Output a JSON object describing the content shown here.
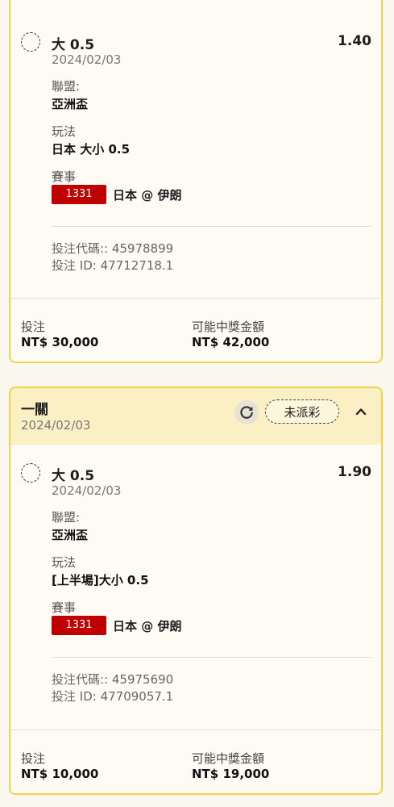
{
  "bets": [
    {
      "leg": {
        "selection": "大 0.5",
        "odds": "1.40",
        "date": "2024/02/03",
        "league_label": "聯盟:",
        "league": "亞洲盃",
        "market_label": "玩法",
        "market": "日本 大小 0.5",
        "match_label": "賽事",
        "match_id": "1331",
        "match_name": "日本 @ 伊朗",
        "bet_code": "投注代碼:: 45978899",
        "bet_id": "投注 ID: 47712718.1"
      },
      "stake_label": "投注",
      "stake": "NT$ 30,000",
      "win_label": "可能中獎金額",
      "win": "NT$ 42,000"
    },
    {
      "header": {
        "title": "一關",
        "date": "2024/02/03",
        "status": "未派彩"
      },
      "leg": {
        "selection": "大 0.5",
        "odds": "1.90",
        "date": "2024/02/03",
        "league_label": "聯盟:",
        "league": "亞洲盃",
        "market_label": "玩法",
        "market": "[上半場]大小 0.5",
        "match_label": "賽事",
        "match_id": "1331",
        "match_name": "日本 @ 伊朗",
        "bet_code": "投注代碼:: 45975690",
        "bet_id": "投注 ID: 47709057.1"
      },
      "stake_label": "投注",
      "stake": "NT$ 10,000",
      "win_label": "可能中獎金額",
      "win": "NT$ 19,000"
    }
  ],
  "icons": {
    "refresh": "refresh-icon",
    "collapse": "chevron-up-icon",
    "radio": "radio-unchecked-icon"
  },
  "colors": {
    "accent_border": "#f3d34a",
    "header_bg": "#fbefc4",
    "match_badge": "#c00000"
  }
}
